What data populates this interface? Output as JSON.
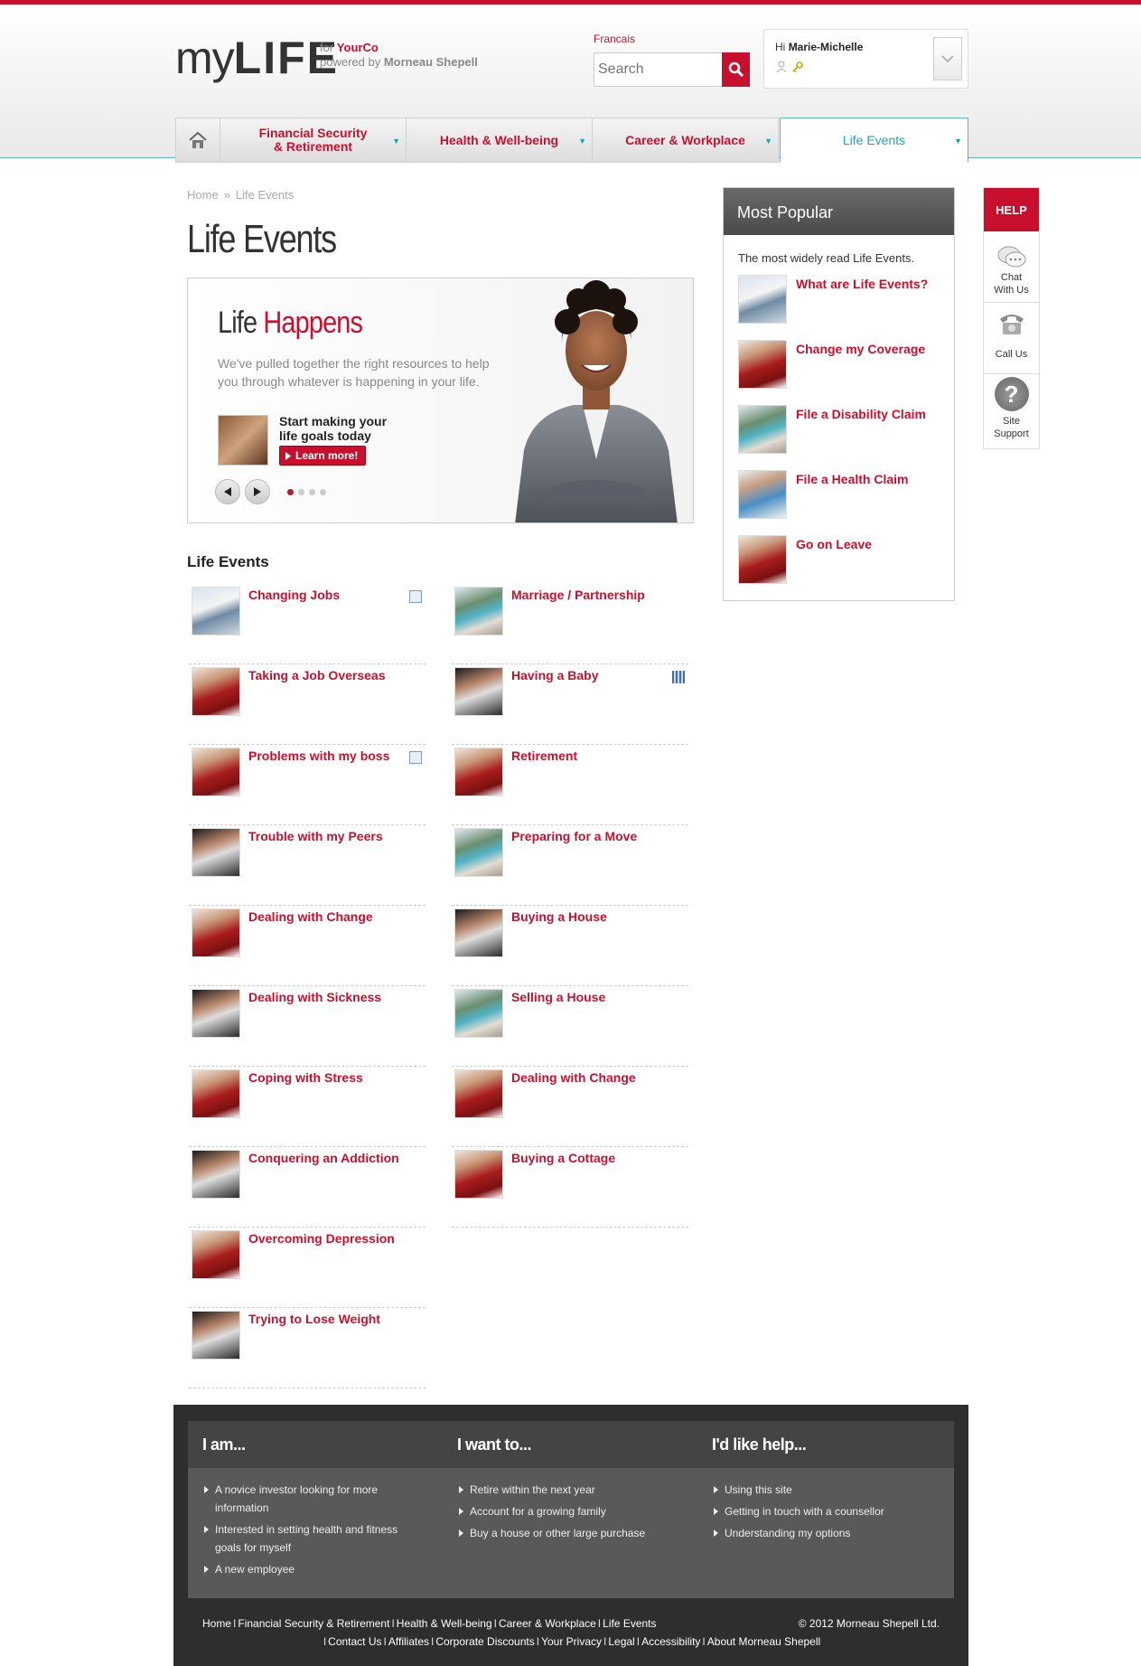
{
  "header": {
    "logo_my": "my",
    "logo_life": "LIFE",
    "for_label": "for",
    "company": "YourCo",
    "powered_label": "powered by",
    "powered_by": "Morneau Shepell",
    "language_link": "Francais",
    "search_placeholder": "Search",
    "greeting": "Hi",
    "user_name": "Marie-Michelle"
  },
  "nav": {
    "items": [
      {
        "line1": "Financial Security",
        "line2": "& Retirement"
      },
      {
        "line1": "Health & Well-being",
        "line2": ""
      },
      {
        "line1": "Career & Workplace",
        "line2": ""
      },
      {
        "line1": "Life Events",
        "line2": ""
      }
    ],
    "active_index": 3
  },
  "breadcrumb": {
    "home": "Home",
    "sep": "»",
    "current": "Life Events"
  },
  "page_title": "Life Events",
  "hero": {
    "title_plain": "Life",
    "title_accent": "Happens",
    "text": "We've pulled together the right resources to help you through whatever is happening in your life.",
    "cta_line1": "Start making your",
    "cta_line2": "life goals today",
    "button_label": "Learn more!",
    "slide_count": 4,
    "active_slide": 1
  },
  "life_events": {
    "heading": "Life Events",
    "left": [
      {
        "label": "Changing Jobs",
        "thumb": "woman",
        "badge": "document"
      },
      {
        "label": "Taking a Job Overseas",
        "thumb": "man",
        "badge": ""
      },
      {
        "label": "Problems with my boss",
        "thumb": "man",
        "badge": "document"
      },
      {
        "label": "Trouble with my Peers",
        "thumb": "hands",
        "badge": ""
      },
      {
        "label": "Dealing with Change",
        "thumb": "man",
        "badge": ""
      },
      {
        "label": "Dealing with Sickness",
        "thumb": "hands",
        "badge": ""
      },
      {
        "label": "Coping with Stress",
        "thumb": "man",
        "badge": ""
      },
      {
        "label": "Conquering an Addiction",
        "thumb": "hands",
        "badge": ""
      },
      {
        "label": "Overcoming Depression",
        "thumb": "man",
        "badge": ""
      },
      {
        "label": "Trying to Lose Weight",
        "thumb": "hands",
        "badge": ""
      }
    ],
    "right": [
      {
        "label": "Marriage / Partnership",
        "thumb": "couple",
        "badge": ""
      },
      {
        "label": "Having a Baby",
        "thumb": "hands",
        "badge": "video"
      },
      {
        "label": "Retirement",
        "thumb": "man",
        "badge": ""
      },
      {
        "label": "Preparing for a Move",
        "thumb": "couple",
        "badge": ""
      },
      {
        "label": "Buying a House",
        "thumb": "hands",
        "badge": ""
      },
      {
        "label": "Selling a House",
        "thumb": "couple",
        "badge": ""
      },
      {
        "label": "Dealing with Change",
        "thumb": "man",
        "badge": ""
      },
      {
        "label": "Buying a Cottage",
        "thumb": "man",
        "badge": ""
      }
    ]
  },
  "most_popular": {
    "heading": "Most Popular",
    "intro": "The most widely read Life Events.",
    "items": [
      {
        "label": "What are Life Events?",
        "thumb": "woman"
      },
      {
        "label": "Change my Coverage",
        "thumb": "man"
      },
      {
        "label": "File a Disability Claim",
        "thumb": "couple"
      },
      {
        "label": "File a Health Claim",
        "thumb": "family"
      },
      {
        "label": "Go on Leave",
        "thumb": "man"
      }
    ]
  },
  "help": {
    "heading": "HELP",
    "items": [
      {
        "line1": "Chat",
        "line2": "With Us"
      },
      {
        "line1": "Call Us",
        "line2": ""
      },
      {
        "line1": "Site",
        "line2": "Support"
      }
    ]
  },
  "footer": {
    "columns": [
      {
        "title": "I am...",
        "items": [
          "A novice investor looking for more information",
          "Interested in setting health and fitness goals for myself",
          "A new employee"
        ]
      },
      {
        "title": "I want to...",
        "items": [
          "Retire within the next year",
          "Account for a growing family",
          "Buy a house or other large purchase"
        ]
      },
      {
        "title": "I'd like help...",
        "items": [
          "Using this site",
          "Getting in touch with a counsellor",
          "Understanding my options"
        ]
      }
    ],
    "links_row1": [
      "Home",
      "Financial Security & Retirement",
      "Health & Well-being",
      "Career & Workplace",
      "Life Events"
    ],
    "links_row2": [
      "Contact Us",
      "Affiliates",
      "Corporate Discounts",
      "Your Privacy",
      "Legal",
      "Accessibility",
      "About Morneau Shepell"
    ],
    "copyright": "© 2012 Morneau Shepell Ltd.",
    "separator": "I"
  },
  "colors": {
    "brand_red": "#c8102e",
    "teal": "#1aa5b3",
    "footer_dark": "#2e2e2e"
  }
}
